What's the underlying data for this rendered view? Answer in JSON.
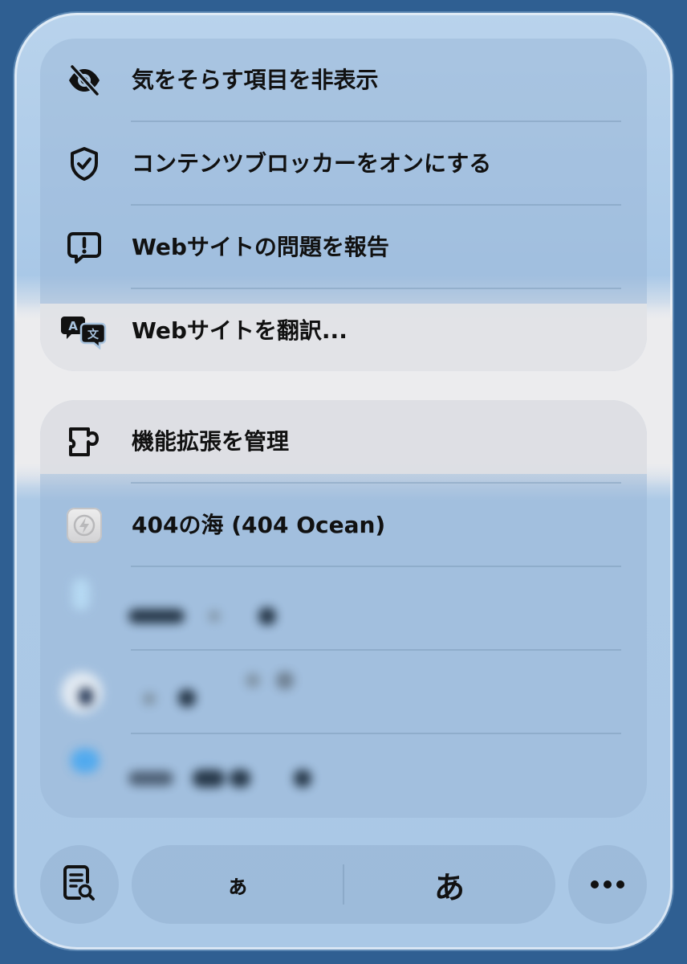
{
  "menu_primary": {
    "items": [
      {
        "label": "気をそらす項目を非表示",
        "icon": "eye-slash-icon"
      },
      {
        "label": "コンテンツブロッカーをオンにする",
        "icon": "shield-check-icon"
      },
      {
        "label": "Webサイトの問題を報告",
        "icon": "exclamation-bubble-icon"
      },
      {
        "label": "Webサイトを翻訳...",
        "icon": "translate-icon"
      }
    ]
  },
  "menu_extensions": {
    "items": [
      {
        "label": "機能拡張を管理",
        "icon": "puzzle-piece-icon"
      },
      {
        "label": "404の海 (404 Ocean)",
        "icon": "extension-app-icon"
      }
    ]
  },
  "bottom_bar": {
    "reader_icon": "reader-search-icon",
    "text_smaller_label": "ぁ",
    "text_larger_label": "あ",
    "more_icon": "ellipsis-icon"
  },
  "colors": {
    "background": "#2f5f92",
    "panel": "#aac8e6",
    "text": "#111111"
  }
}
